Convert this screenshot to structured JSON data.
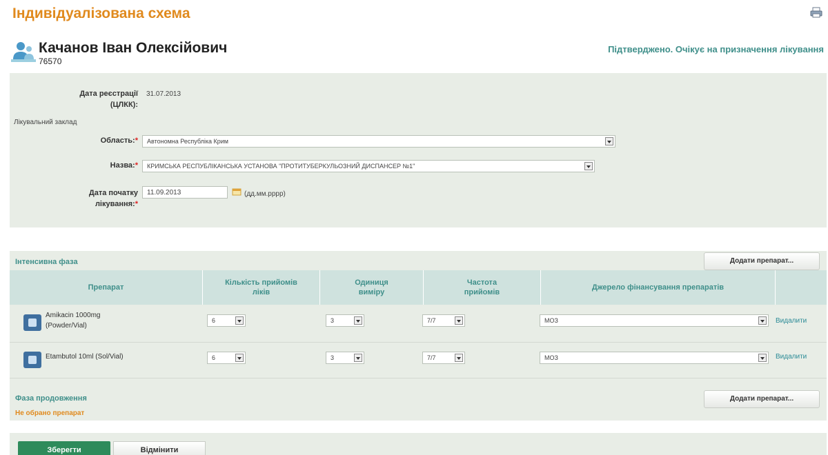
{
  "header": {
    "title": "Індивідуалізована схема",
    "print_icon": "printer-icon",
    "person_name": "Качанов Іван Олексійович",
    "person_id": "76570",
    "status": "Підтверджено. Очікує на призначення лікування"
  },
  "registration": {
    "date_label_line1": "Дата реєстрації",
    "date_label_line2": "(ЦЛКК):",
    "date_value": "31.07.2013",
    "facility_heading": "Лікувальний заклад",
    "region_label": "Область:",
    "region_value": "Автономна Республіка Крим",
    "name_label": "Назва:",
    "name_value": "КРИМСЬКА РЕСПУБЛІКАНСЬКА УСТАНОВА \"ПРОТИТУБЕРКУЛЬОЗНИЙ ДИСПАНСЕР №1\"",
    "start_label_line1": "Дата початку",
    "start_label_line2": "лікування:",
    "start_value": "11.09.2013",
    "date_format_hint": "(дд.мм.рррр)",
    "required_mark": "*"
  },
  "intensive_phase": {
    "label": "Інтенсивна фаза",
    "add_button": "Додати препарат...",
    "columns": [
      "Препарат",
      "Кількість прийомів ліків",
      "Одиниця виміру",
      "Частота прийомів",
      "Джерело фінансування препаратів"
    ],
    "rows": [
      {
        "drug_line1": "Amikacin 1000mg",
        "drug_line2": "(Powder/Vial)",
        "qty": "6",
        "unit": "3",
        "freq": "7/7",
        "source": "МОЗ",
        "delete": "Видалити"
      },
      {
        "drug_line1": "Etambutol 10ml (Sol/Vial)",
        "drug_line2": "",
        "qty": "6",
        "unit": "3",
        "freq": "7/7",
        "source": "МОЗ",
        "delete": "Видалити"
      }
    ]
  },
  "continuation_phase": {
    "label": "Фаза продовження",
    "empty_text": "Не обрано препарат",
    "add_button": "Додати препарат..."
  },
  "footer": {
    "save_label": "Зберегти",
    "cancel_label": "Відмінити"
  },
  "colors": {
    "title_orange": "#e08a1e",
    "status_teal": "#3f8f8a",
    "panel_bg": "#e8ede6",
    "table_header_bg": "#cfe2de",
    "save_green": "#2e8b5b"
  }
}
